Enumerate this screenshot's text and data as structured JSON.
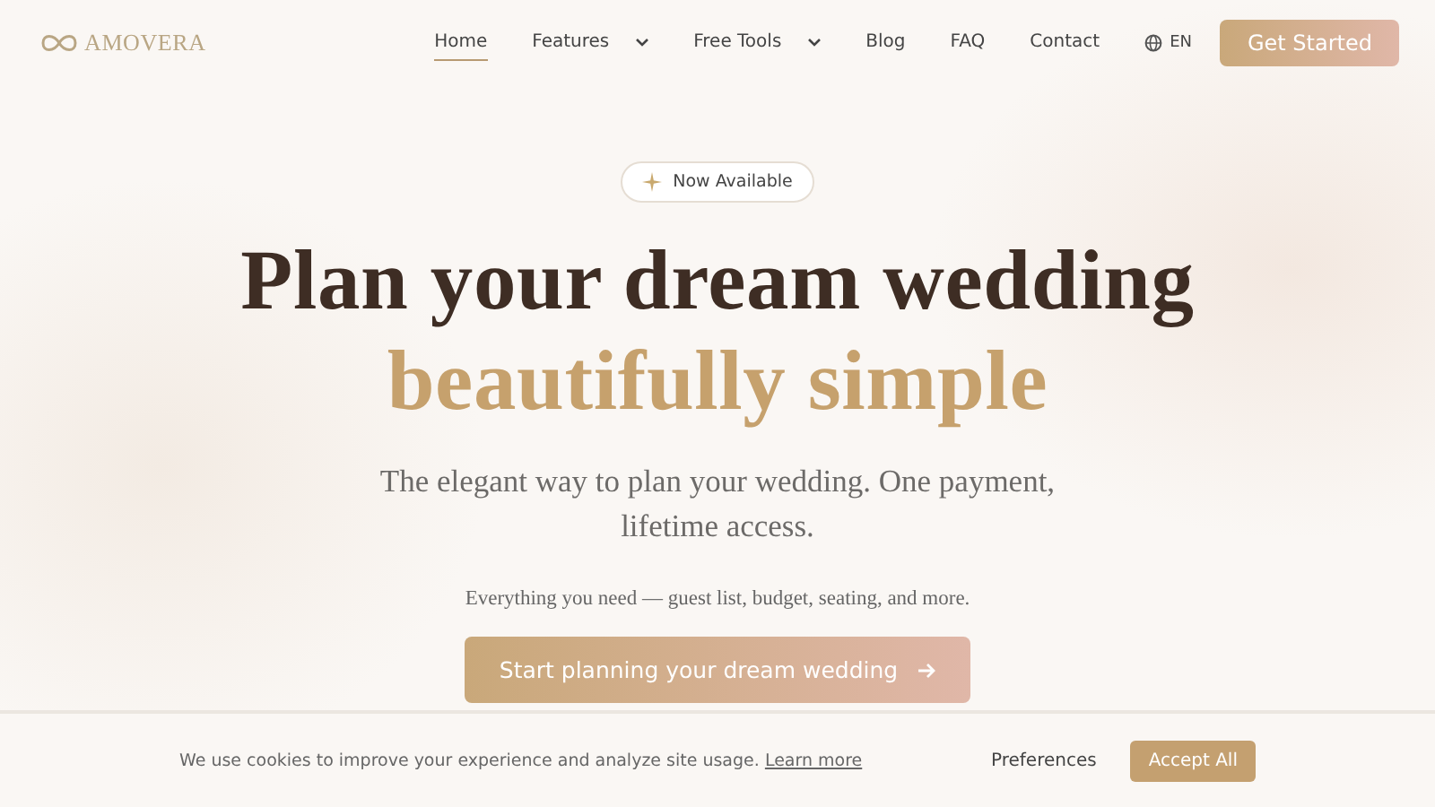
{
  "header": {
    "logo": "AMOVERA",
    "nav": [
      {
        "label": "Home",
        "selected": true,
        "dropdown": false
      },
      {
        "label": "Features",
        "selected": false,
        "dropdown": true
      },
      {
        "label": "Free Tools",
        "selected": false,
        "dropdown": true
      },
      {
        "label": "Blog",
        "selected": false,
        "dropdown": false
      },
      {
        "label": "FAQ",
        "selected": false,
        "dropdown": false
      },
      {
        "label": "Contact",
        "selected": false,
        "dropdown": false
      }
    ],
    "language": "EN",
    "cta": "Get Started"
  },
  "hero": {
    "badge": "Now Available",
    "title_line_1": "Plan your dream wedding",
    "title_line_2": "beautifully simple",
    "subtitle": "The elegant way to plan your wedding. One payment, lifetime access.",
    "note": "Everything you need — guest list, budget, seating, and more.",
    "cta": "Start planning your dream wedding"
  },
  "cookie_banner": {
    "text": "We use cookies to improve your experience and analyze site usage.",
    "link": "Learn more",
    "preferences": "Preferences",
    "accept": "Accept All"
  }
}
